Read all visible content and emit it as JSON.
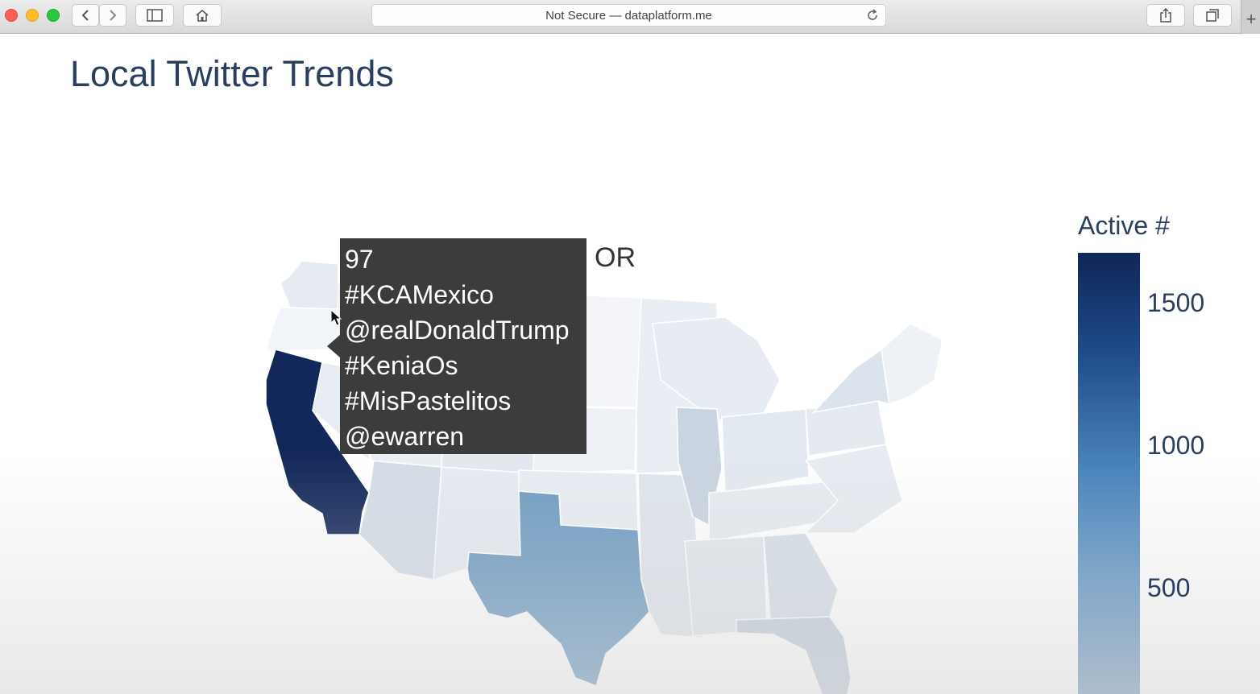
{
  "browser": {
    "address": "Not Secure — dataplatform.me"
  },
  "page": {
    "title": "Local Twitter Trends"
  },
  "tooltip": {
    "lines": [
      "97",
      "#KCAMexico",
      "@realDonaldTrump",
      "#KeniaOs",
      "#MisPastelitos",
      "@ewarren"
    ],
    "state": "OR"
  },
  "colorbar": {
    "title": "Active #",
    "ticks": [
      "1500",
      "1000",
      "500"
    ],
    "colors": [
      "#0f2656",
      "#1e4a8a",
      "#4c86be",
      "#7fa6c8",
      "#aebdcd"
    ]
  },
  "map": {
    "highlighted_states": [
      {
        "state": "CA",
        "level": "high",
        "color": "#13285a"
      },
      {
        "state": "TX",
        "level": "medium",
        "color": "#6f9cc2"
      }
    ]
  }
}
